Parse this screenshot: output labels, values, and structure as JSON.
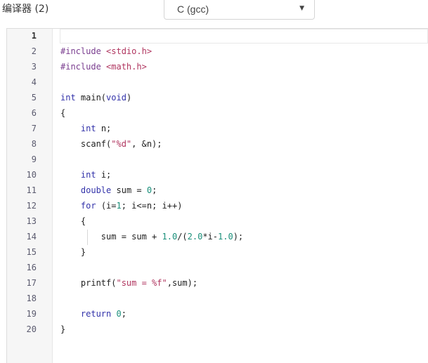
{
  "toolbar": {
    "compiler_label": "编译器 (2)",
    "compiler_select": {
      "value": "C (gcc)",
      "caret_icon": "caret-down-icon"
    }
  },
  "editor": {
    "active_line": 1,
    "lines": [
      {
        "number": "1",
        "tokens": []
      },
      {
        "number": "2",
        "tokens": [
          {
            "t": "#include",
            "c": "ppkw"
          },
          {
            "t": " ",
            "c": ""
          },
          {
            "t": "<stdio.h>",
            "c": "inc"
          }
        ]
      },
      {
        "number": "3",
        "tokens": [
          {
            "t": "#include",
            "c": "ppkw"
          },
          {
            "t": " ",
            "c": ""
          },
          {
            "t": "<math.h>",
            "c": "inc"
          }
        ]
      },
      {
        "number": "4",
        "tokens": []
      },
      {
        "number": "5",
        "tokens": [
          {
            "t": "int",
            "c": "type"
          },
          {
            "t": " main(",
            "c": ""
          },
          {
            "t": "void",
            "c": "type"
          },
          {
            "t": ")",
            "c": ""
          }
        ]
      },
      {
        "number": "6",
        "tokens": [
          {
            "t": "{",
            "c": ""
          }
        ]
      },
      {
        "number": "7",
        "tokens": [
          {
            "t": "    ",
            "c": ""
          },
          {
            "t": "int",
            "c": "type"
          },
          {
            "t": " n;",
            "c": ""
          }
        ]
      },
      {
        "number": "8",
        "tokens": [
          {
            "t": "    scanf(",
            "c": ""
          },
          {
            "t": "\"%d\"",
            "c": "str"
          },
          {
            "t": ", &n);",
            "c": ""
          }
        ]
      },
      {
        "number": "9",
        "tokens": []
      },
      {
        "number": "10",
        "tokens": [
          {
            "t": "    ",
            "c": ""
          },
          {
            "t": "int",
            "c": "type"
          },
          {
            "t": " i;",
            "c": ""
          }
        ]
      },
      {
        "number": "11",
        "tokens": [
          {
            "t": "    ",
            "c": ""
          },
          {
            "t": "double",
            "c": "type"
          },
          {
            "t": " sum = ",
            "c": ""
          },
          {
            "t": "0",
            "c": "num"
          },
          {
            "t": ";",
            "c": ""
          }
        ]
      },
      {
        "number": "12",
        "tokens": [
          {
            "t": "    ",
            "c": ""
          },
          {
            "t": "for",
            "c": "kw"
          },
          {
            "t": " (i=",
            "c": ""
          },
          {
            "t": "1",
            "c": "num"
          },
          {
            "t": "; i<=n; i++)",
            "c": ""
          }
        ]
      },
      {
        "number": "13",
        "tokens": [
          {
            "t": "    {",
            "c": ""
          }
        ]
      },
      {
        "number": "14",
        "tokens": [
          {
            "t": "        sum = sum + ",
            "c": ""
          },
          {
            "t": "1.0",
            "c": "num"
          },
          {
            "t": "/(",
            "c": ""
          },
          {
            "t": "2.0",
            "c": "num"
          },
          {
            "t": "*i-",
            "c": ""
          },
          {
            "t": "1.0",
            "c": "num"
          },
          {
            "t": ");",
            "c": ""
          }
        ]
      },
      {
        "number": "15",
        "tokens": [
          {
            "t": "    }",
            "c": ""
          }
        ]
      },
      {
        "number": "16",
        "tokens": []
      },
      {
        "number": "17",
        "tokens": [
          {
            "t": "    printf(",
            "c": ""
          },
          {
            "t": "\"sum = %f\"",
            "c": "str"
          },
          {
            "t": ",sum);",
            "c": ""
          }
        ]
      },
      {
        "number": "18",
        "tokens": []
      },
      {
        "number": "19",
        "tokens": [
          {
            "t": "    ",
            "c": ""
          },
          {
            "t": "return",
            "c": "kw"
          },
          {
            "t": " ",
            "c": ""
          },
          {
            "t": "0",
            "c": "num"
          },
          {
            "t": ";",
            "c": ""
          }
        ]
      },
      {
        "number": "20",
        "tokens": [
          {
            "t": "}",
            "c": ""
          }
        ]
      }
    ]
  },
  "colors": {
    "keyword": "#3333aa",
    "preprocessor": "#7a3d8f",
    "string": "#b0355f",
    "number": "#1a8f7a",
    "gutter_bg": "#f6f6f6"
  }
}
